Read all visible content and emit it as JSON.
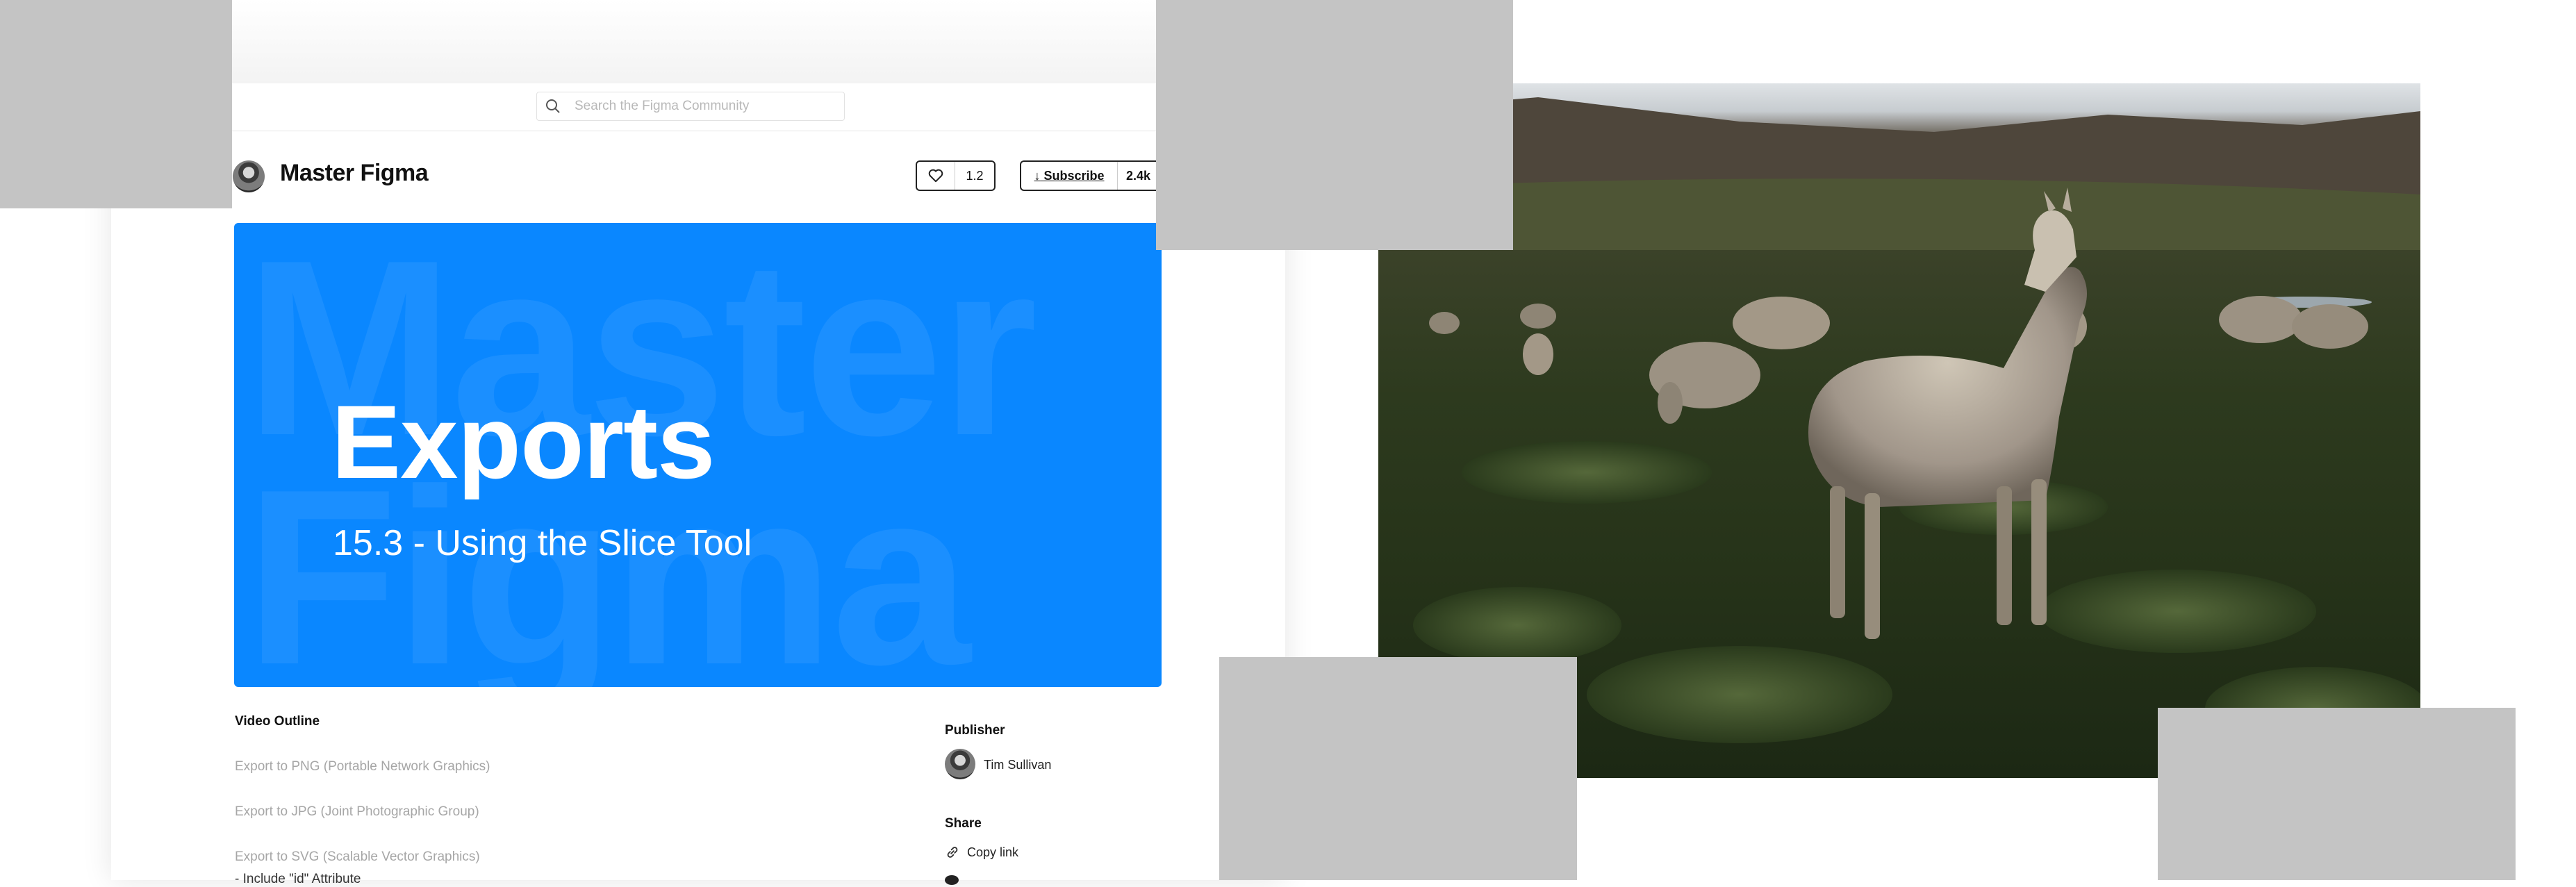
{
  "search": {
    "placeholder": "Search the Figma Community"
  },
  "community": {
    "title": "Master Figma"
  },
  "actions": {
    "like_count": "1.2",
    "subscribe_label": "Subscribe",
    "subscribe_count": "2.4k"
  },
  "hero": {
    "watermark_line1": "Master",
    "watermark_line2": "Figma",
    "title": "Exports",
    "subtitle": "15.3 - Using the Slice Tool"
  },
  "outline": {
    "heading": "Video Outline",
    "items": [
      "Export to PNG (Portable Network Graphics)",
      "Export to JPG (Joint Photographic Group)",
      "Export to SVG (Scalable Vector Graphics)",
      "- Include \"id\" Attribute"
    ]
  },
  "publisher": {
    "heading": "Publisher",
    "name": "Tim Sullivan"
  },
  "share": {
    "heading": "Share",
    "copy_link": "Copy link"
  },
  "colors": {
    "accent": "#0a87ff",
    "placeholder_block": "#c4c4c4"
  }
}
